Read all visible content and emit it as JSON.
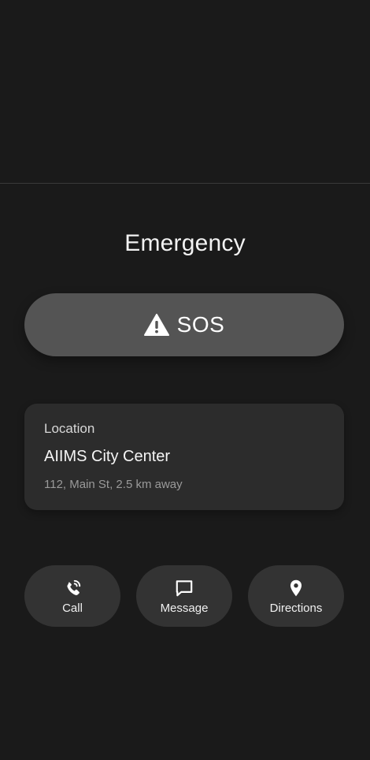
{
  "header": {
    "title": "Emergency"
  },
  "sos": {
    "label": "SOS",
    "icon": "warning-icon"
  },
  "location": {
    "heading": "Location",
    "name": "AIIMS City Center",
    "address": "112, Main St, 2.5 km away"
  },
  "actions": [
    {
      "label": "Call",
      "icon": "phone-call-icon"
    },
    {
      "label": "Message",
      "icon": "message-icon"
    },
    {
      "label": "Directions",
      "icon": "map-pin-icon"
    }
  ],
  "colors": {
    "background": "#1a1a1a",
    "sos_button": "#545454",
    "card": "#2c2c2c",
    "action_button": "#333333"
  }
}
